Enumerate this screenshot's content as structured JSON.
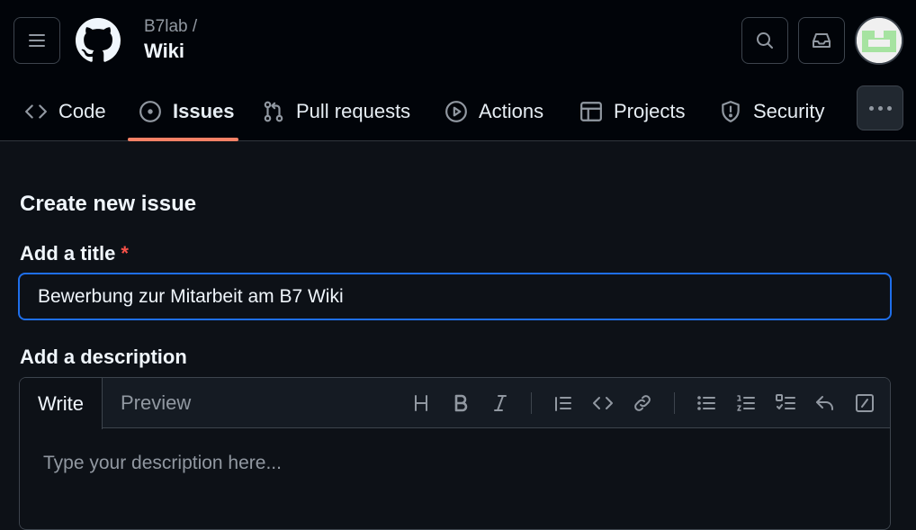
{
  "header": {
    "repo_owner": "B7lab /",
    "repo_name": "Wiki"
  },
  "nav": {
    "tabs": [
      {
        "label": "Code",
        "icon": "code-icon"
      },
      {
        "label": "Issues",
        "icon": "issue-opened-icon",
        "active": true
      },
      {
        "label": "Pull requests",
        "icon": "git-pull-request-icon"
      },
      {
        "label": "Actions",
        "icon": "play-icon"
      },
      {
        "label": "Projects",
        "icon": "table-icon"
      },
      {
        "label": "Security",
        "icon": "shield-icon"
      }
    ]
  },
  "form": {
    "page_title": "Create new issue",
    "title_label": "Add a title",
    "required_mark": "*",
    "title_value": "Bewerbung zur Mitarbeit am B7 Wiki",
    "description_label": "Add a description",
    "editor_tabs": {
      "write": "Write",
      "preview": "Preview"
    },
    "description_placeholder": "Type your description here..."
  },
  "colors": {
    "accent_underline": "#f78166",
    "focus_border": "#1f6feb",
    "required": "#f85149"
  }
}
